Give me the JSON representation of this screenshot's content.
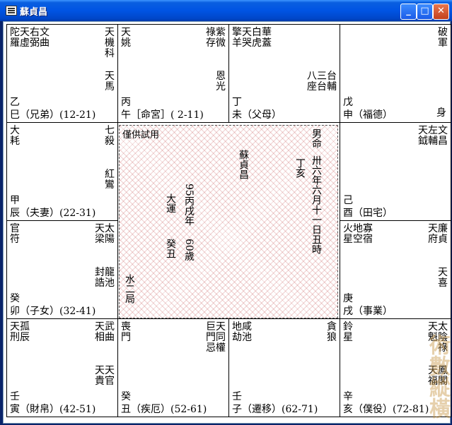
{
  "window": {
    "title": "蘇貞昌",
    "min": "_",
    "max": "□",
    "close": "✕",
    "icon": "window-menu-icon"
  },
  "center": {
    "label": "僅供試用",
    "gender_age": "男命",
    "lunar": "卅六年六月十一日丑時",
    "name": "蘇貞昌",
    "year_gz": "丁亥",
    "dayun_label": "大運",
    "dayun_year": "95丙戌年",
    "dayun_age": "60歲",
    "guichou": "癸丑",
    "bureau": "水二局"
  },
  "palaces": [
    {
      "id": "si",
      "stem": "乙",
      "line": "巳（兄弟）(12-21)",
      "cols": [
        [
          "陀",
          "羅"
        ],
        [
          "天",
          "虛"
        ],
        [
          "右",
          "弼"
        ],
        [
          "文",
          "曲"
        ]
      ],
      "right": [
        [
          "天",
          "機",
          "科"
        ]
      ],
      "extra": [
        [
          "天",
          "馬"
        ]
      ]
    },
    {
      "id": "wu",
      "stem": "丙",
      "line": "午［命宮］( 2-11)",
      "cols": [
        [
          "天",
          "姚"
        ]
      ],
      "right": [
        [
          "祿",
          "存"
        ],
        [
          "紫",
          "微"
        ]
      ],
      "extra": [
        [
          "恩",
          "光"
        ]
      ]
    },
    {
      "id": "wei",
      "stem": "丁",
      "line": "未（父母）",
      "cols": [
        [
          "擎",
          "羊"
        ],
        [
          "天",
          "哭"
        ],
        [
          "白",
          "虎"
        ],
        [
          "華",
          "蓋"
        ]
      ],
      "right": [],
      "extra": [
        [
          "八",
          "座"
        ],
        [
          "三",
          "台"
        ],
        [
          "台",
          "輔"
        ]
      ]
    },
    {
      "id": "shen",
      "stem": "戊",
      "line": "申（福德）",
      "cols": [],
      "right": [
        [
          "破",
          "軍"
        ]
      ],
      "extra": [],
      "shen": "身"
    },
    {
      "id": "chen",
      "stem": "甲",
      "line": "辰（夫妻）(22-31)",
      "cols": [
        [
          "大",
          "耗"
        ]
      ],
      "right": [
        [
          "七",
          "殺"
        ]
      ],
      "extra": [
        [
          "紅",
          "鸞"
        ]
      ]
    },
    {
      "id": "you",
      "stem": "己",
      "line": "酉（田宅）",
      "cols": [],
      "right": [
        [
          "天",
          "鉞"
        ],
        [
          "左",
          "輔"
        ],
        [
          "文",
          "昌"
        ]
      ],
      "extra": []
    },
    {
      "id": "mao",
      "stem": "癸",
      "line": "卯（子女）(32-41)",
      "cols": [
        [
          "官",
          "符"
        ]
      ],
      "right": [
        [
          "天",
          "梁"
        ],
        [
          "太",
          "陽"
        ]
      ],
      "extra": [
        [
          "封",
          "誥"
        ],
        [
          "龍",
          "池"
        ]
      ]
    },
    {
      "id": "xu",
      "stem": "庚",
      "line": "戌（事業）",
      "cols": [
        [
          "火",
          "星"
        ],
        [
          "地",
          "空"
        ],
        [
          "寡",
          "宿"
        ]
      ],
      "right": [
        [
          "天",
          "府"
        ],
        [
          "廉",
          "貞"
        ]
      ],
      "extra": [
        [
          "天",
          "喜"
        ]
      ]
    },
    {
      "id": "yin",
      "stem": "壬",
      "line": "寅（財帛）(42-51)",
      "cols": [
        [
          "天",
          "刑"
        ],
        [
          "孤",
          "辰"
        ]
      ],
      "right": [
        [
          "天",
          "相"
        ],
        [
          "武",
          "曲"
        ]
      ],
      "extra": [
        [
          "天",
          "貴"
        ],
        [
          "天",
          "官"
        ]
      ]
    },
    {
      "id": "chou",
      "stem": "癸",
      "line": "丑（疾厄）(52-61)",
      "cols": [
        [
          "喪",
          "門"
        ]
      ],
      "right": [
        [
          "巨",
          "門",
          "忌"
        ],
        [
          "天",
          "同",
          "權"
        ]
      ],
      "extra": []
    },
    {
      "id": "zi",
      "stem": "壬",
      "line": "子（遷移）(62-71)",
      "cols": [
        [
          "地",
          "劫"
        ],
        [
          "咸",
          "池"
        ]
      ],
      "right": [
        [
          "貪",
          "狼"
        ]
      ],
      "extra": []
    },
    {
      "id": "hai",
      "stem": "辛",
      "line": "亥（僕役）(72-81)",
      "cols": [
        [
          "鈴",
          "星"
        ]
      ],
      "right": [
        [
          "天",
          "魁"
        ],
        [
          "太",
          "陰",
          "祿"
        ]
      ],
      "extra": [
        [
          "天",
          "福"
        ],
        [
          "鳳",
          "閣"
        ]
      ]
    }
  ],
  "watermark": "術數縱橫"
}
